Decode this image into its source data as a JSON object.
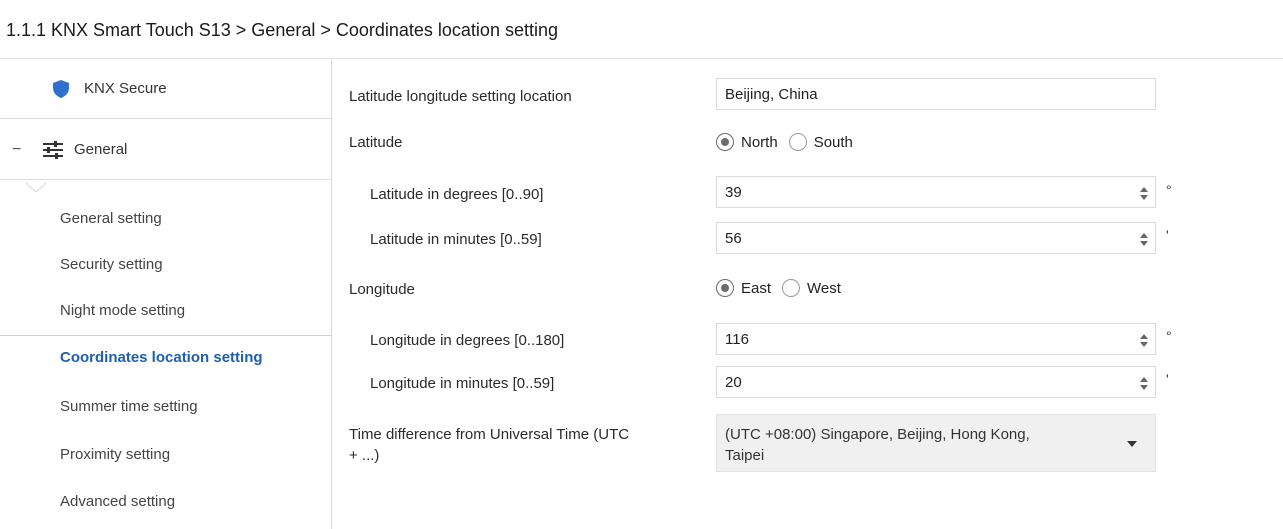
{
  "header": {
    "title": "1.1.1 KNX Smart Touch S13 > General > Coordinates location setting"
  },
  "sidebar": {
    "secure": {
      "label": "KNX Secure",
      "icon": "shield-icon"
    },
    "general": {
      "collapse_symbol": "−",
      "label": "General",
      "icon": "sliders-icon"
    },
    "items": [
      {
        "label": "General setting"
      },
      {
        "label": "Security setting"
      },
      {
        "label": "Night mode setting"
      },
      {
        "label": "Coordinates location setting"
      },
      {
        "label": "Summer time setting"
      },
      {
        "label": "Proximity setting"
      },
      {
        "label": "Advanced setting"
      }
    ],
    "active_index": 3
  },
  "form": {
    "location": {
      "label": "Latitude longitude setting location",
      "value": "Beijing, China"
    },
    "latitude": {
      "label": "Latitude",
      "options": [
        "North",
        "South"
      ],
      "selected": "North"
    },
    "lat_degrees": {
      "label": "Latitude in degrees [0..90]",
      "value": "39",
      "unit": "°"
    },
    "lat_minutes": {
      "label": "Latitude in minutes [0..59]",
      "value": "56",
      "unit": "'"
    },
    "longitude": {
      "label": "Longitude",
      "options": [
        "East",
        "West"
      ],
      "selected": "East"
    },
    "lon_degrees": {
      "label": "Longitude in degrees [0..180]",
      "value": "116",
      "unit": "°"
    },
    "lon_minutes": {
      "label": "Longitude in minutes [0..59]",
      "value": "20",
      "unit": "'"
    },
    "timezone": {
      "label_line1": "Time difference from Universal Time (UTC",
      "label_line2": "+ ...)",
      "value_line1": "(UTC +08:00) Singapore,  Beijing, Hong Kong,",
      "value_line2": "Taipei"
    }
  },
  "colors": {
    "active": "#1e5fb0",
    "shield": "#2f6fcf"
  }
}
